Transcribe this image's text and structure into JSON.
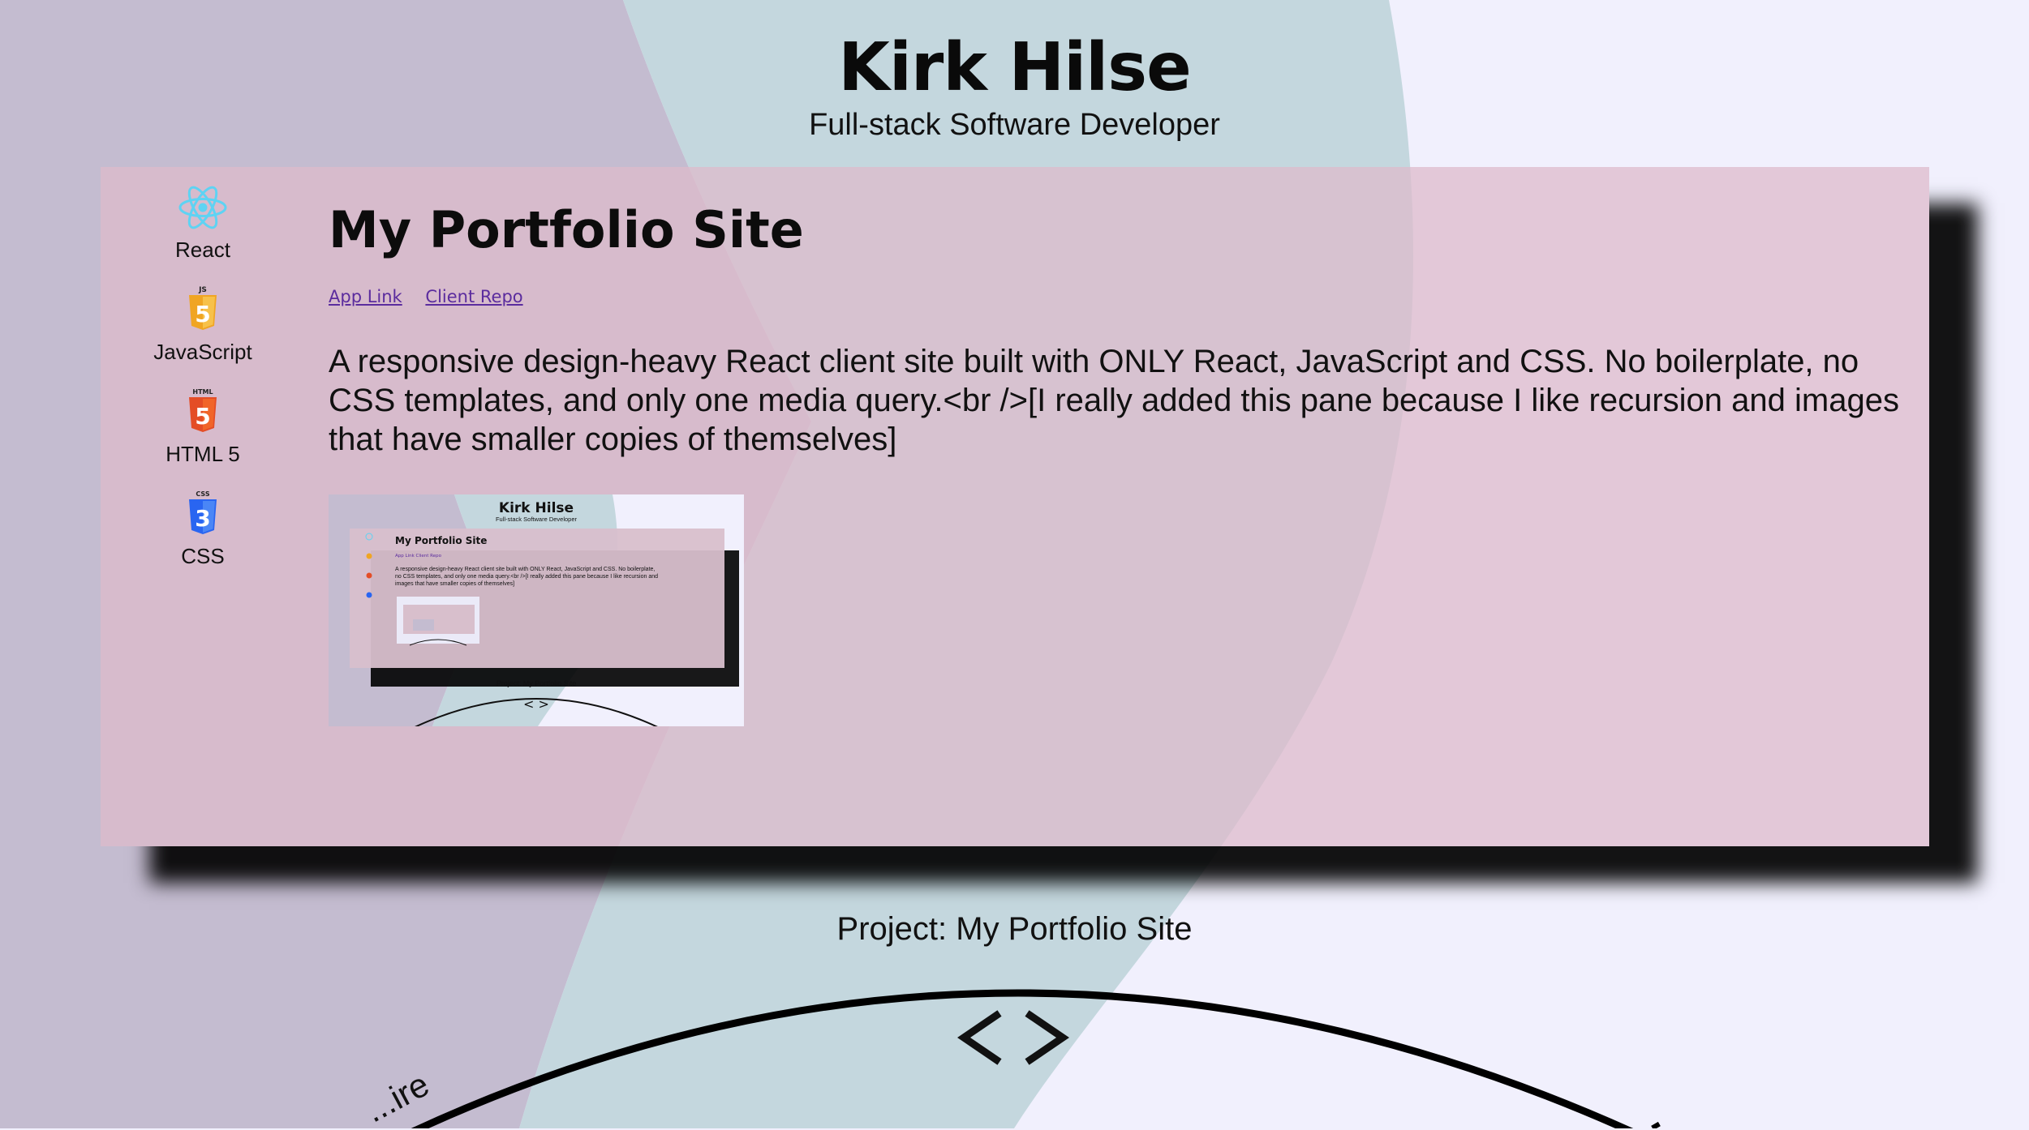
{
  "header": {
    "name": "Kirk Hilse",
    "tagline": "Full-stack Software Developer"
  },
  "project": {
    "title": "My Portfolio Site",
    "links": [
      {
        "label": "App Link"
      },
      {
        "label": "Client Repo"
      }
    ],
    "description": "A responsive design-heavy React client site built with ONLY React, JavaScript and CSS. No boilerplate, no CSS templates, and only one media query.<br />[I really added this pane because I like recursion and images that have smaller copies of themselves]",
    "tech": [
      {
        "label": "React",
        "icon": "react-icon"
      },
      {
        "label": "JavaScript",
        "icon": "javascript-icon"
      },
      {
        "label": "HTML 5",
        "icon": "html5-icon"
      },
      {
        "label": "CSS",
        "icon": "css3-icon"
      }
    ]
  },
  "thumbnail": {
    "name": "Kirk Hilse",
    "tagline": "Full-stack Software Developer",
    "title": "My Portfolio Site",
    "links": "App Link   Client Repo",
    "description_lines": [
      "A responsive design-heavy React client site built with ONLY React, JavaScript and CSS. No boilerplate,",
      "no CSS templates, and only one media query.<br />[I really added this pane because I like recursion and",
      "images that have smaller copies of themselves]"
    ],
    "caption": "Project: My Portfolio Site",
    "code_glyph": "< >"
  },
  "carousel": {
    "caption": "Project: My Portfolio Site",
    "partial_label": "...ire",
    "code_icon": "code-brackets-icon"
  },
  "colors": {
    "page_bg": "#f1f0fd",
    "left_shape": "#c4bcd0",
    "middle_shape": "#c4d7de",
    "pane_bg": "#d8bfcc",
    "link": "#5b2c9e",
    "react": "#5ed3f3",
    "javascript": "#f0a523",
    "html5": "#e44d26",
    "css3": "#2965f1"
  }
}
